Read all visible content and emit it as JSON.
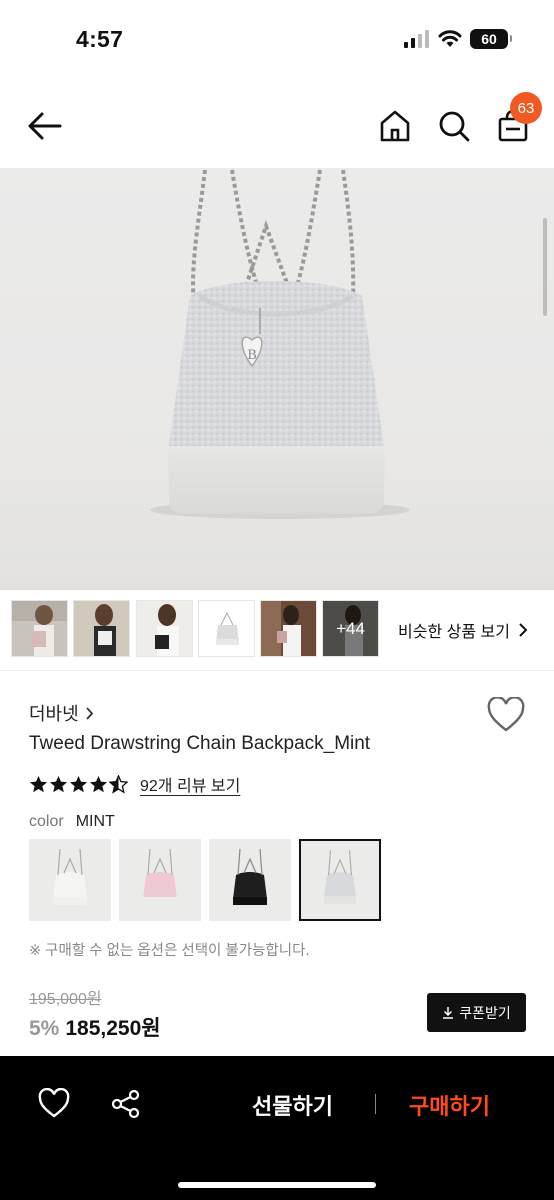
{
  "status": {
    "time": "4:57",
    "battery": "60"
  },
  "header": {
    "cart_count": "63"
  },
  "thumbnails": {
    "more_count": "+44",
    "similar_label": "비슷한 상품 보기"
  },
  "product": {
    "brand": "더바넷",
    "title": "Tweed Drawstring Chain Backpack_Mint",
    "rating": 4.5,
    "review_link": "92개 리뷰 보기",
    "color_label": "color",
    "color_value": "MINT",
    "notice": "※ 구매할 수 없는 옵션은 선택이 불가능합니다.",
    "original_price": "195,000원",
    "discount": "5%",
    "price": "185,250원",
    "coupon_label": "쿠폰받기"
  },
  "bottom_bar": {
    "gift_label": "선물하기",
    "buy_label": "구매하기"
  },
  "colors": {
    "accent": "#f05a22",
    "buy": "#ff4a1c"
  }
}
